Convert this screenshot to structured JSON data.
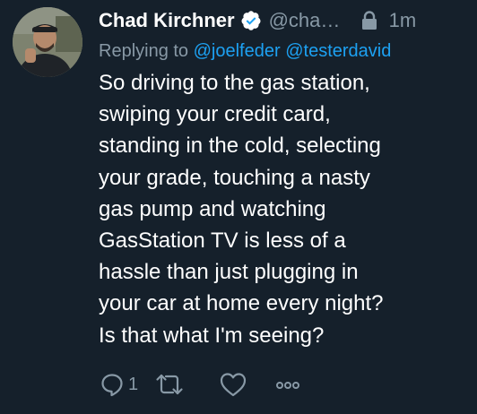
{
  "tweet": {
    "display_name": "Chad Kirchner",
    "handle": "@chadkirchner",
    "timestamp": "1m",
    "replying_prefix": "Replying to",
    "replying_mentions": [
      "@joelfeder",
      "@testerdavid"
    ],
    "text_lines": [
      "So driving to the gas station,",
      "swiping your credit card,",
      "standing in the cold, selecting",
      "your grade, touching a nasty",
      "gas pump and watching",
      "GasStation TV is less of a",
      "hassle than just plugging in",
      "your car at home every night?",
      "Is that what I'm seeing?"
    ],
    "reply_count": "1"
  },
  "icons": {
    "verified": "verified-badge-icon",
    "protected": "lock-icon",
    "reply": "reply-icon",
    "retweet": "retweet-icon",
    "like": "heart-icon",
    "more": "more-icon"
  },
  "colors": {
    "background": "#15202b",
    "primary_text": "#ffffff",
    "secondary_text": "#8899a6",
    "link": "#1da1f2"
  }
}
